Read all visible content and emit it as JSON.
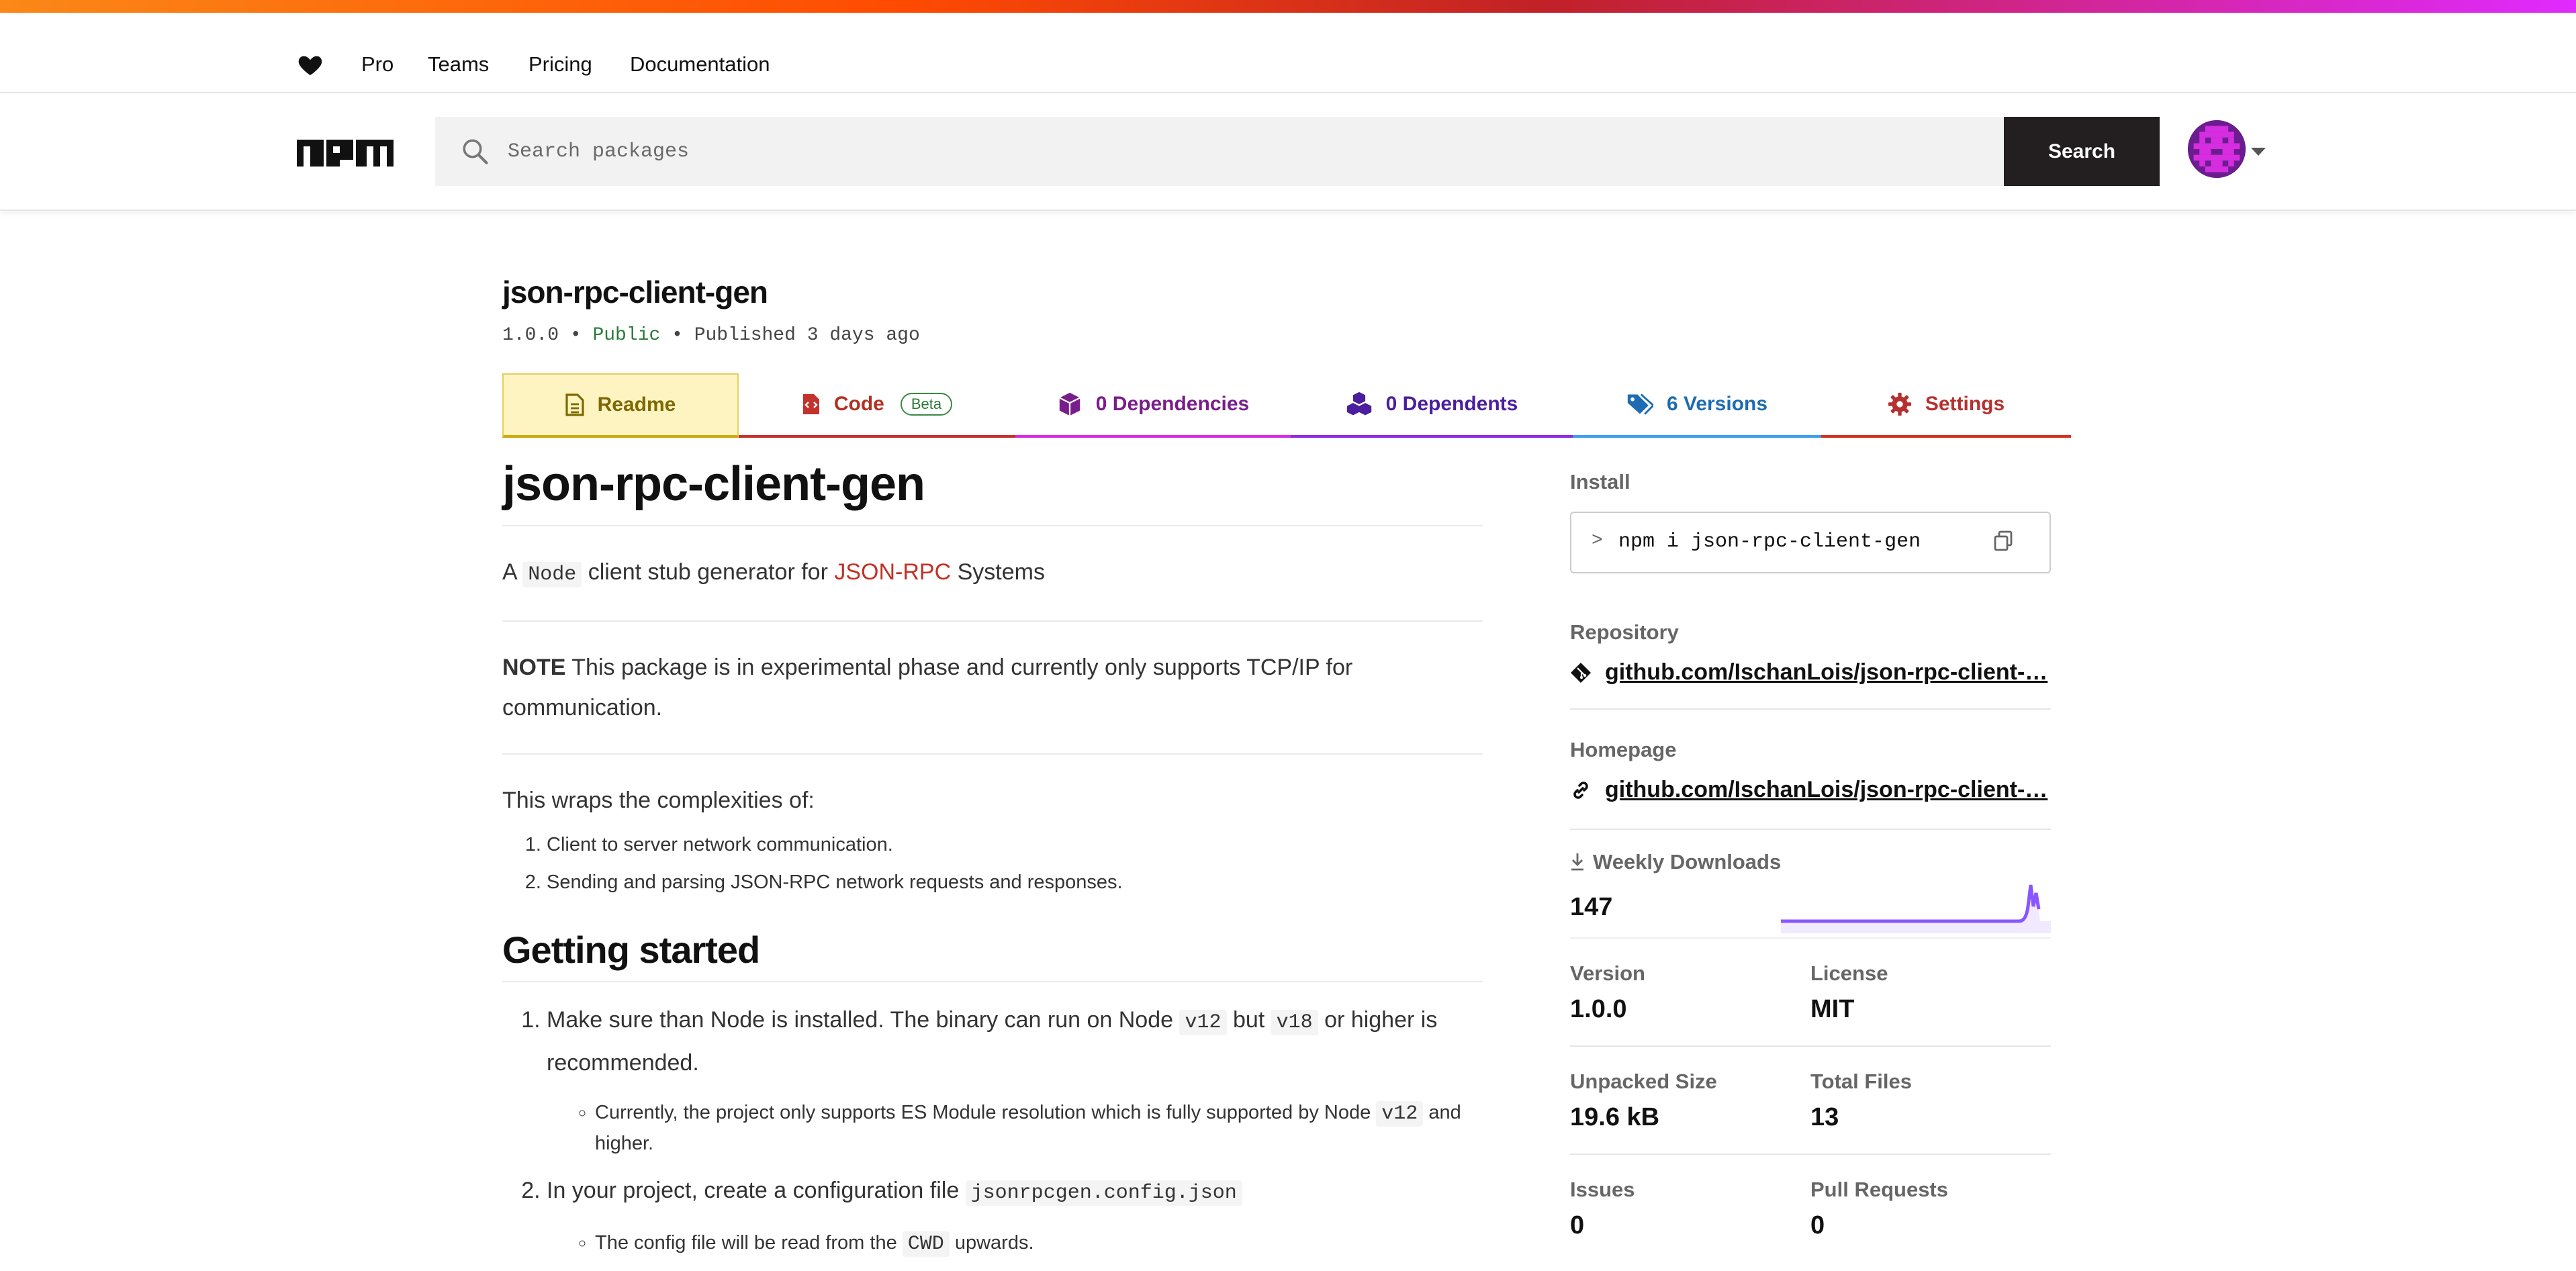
{
  "nav": {
    "links": [
      "Pro",
      "Teams",
      "Pricing",
      "Documentation"
    ]
  },
  "search": {
    "placeholder": "Search packages",
    "button_label": "Search"
  },
  "package": {
    "name": "json-rpc-client-gen",
    "version": "1.0.0",
    "visibility": "Public",
    "published": "Published 3 days ago"
  },
  "tabs": {
    "readme": "Readme",
    "code": "Code",
    "code_badge": "Beta",
    "dependencies": "0 Dependencies",
    "dependents": "0 Dependents",
    "versions": "6 Versions",
    "settings": "Settings"
  },
  "readme": {
    "title": "json-rpc-client-gen",
    "intro_a": "A ",
    "intro_code": "Node",
    "intro_b": " client stub generator for ",
    "intro_link": "JSON-RPC",
    "intro_c": " Systems",
    "note_label": "NOTE",
    "note_text": " This package is in experimental phase and currently only supports TCP/IP for communication.",
    "wraps": "This wraps the complexities of:",
    "wraps_items": [
      "Client to server network communication.",
      "Sending and parsing JSON-RPC network requests and responses."
    ],
    "getting_started": "Getting started",
    "step1_a": "Make sure than Node is installed. The binary can run on Node ",
    "step1_code1": "v12",
    "step1_b": " but ",
    "step1_code2": "v18",
    "step1_c": " or higher is recommended.",
    "step1_sub_a": "Currently, the project only supports ES Module resolution which is fully supported by Node ",
    "step1_sub_code": "v12",
    "step1_sub_b": " and higher.",
    "step2_a": "In your project, create a configuration file ",
    "step2_code": "jsonrpcgen.config.json",
    "step2_sub_a": "The config file will be read from the ",
    "step2_sub_code": "CWD",
    "step2_sub_b": " upwards."
  },
  "sidebar": {
    "install_label": "Install",
    "install_prompt": ">",
    "install_cmd": "npm i json-rpc-client-gen",
    "repository_label": "Repository",
    "repository_link": "github.com/IschanLois/json-rpc-client-…",
    "homepage_label": "Homepage",
    "homepage_link": "github.com/IschanLois/json-rpc-client-…",
    "weekly_downloads_label": "Weekly Downloads",
    "weekly_downloads": "147",
    "version_label": "Version",
    "version": "1.0.0",
    "license_label": "License",
    "license": "MIT",
    "unpacked_size_label": "Unpacked Size",
    "unpacked_size": "19.6 kB",
    "total_files_label": "Total Files",
    "total_files": "13",
    "issues_label": "Issues",
    "issues": "0",
    "pull_requests_label": "Pull Requests",
    "pull_requests": "0"
  },
  "colors": {
    "accent": "#cb3837",
    "public": "#2b7a3b",
    "sparkline": "#8956ff"
  }
}
